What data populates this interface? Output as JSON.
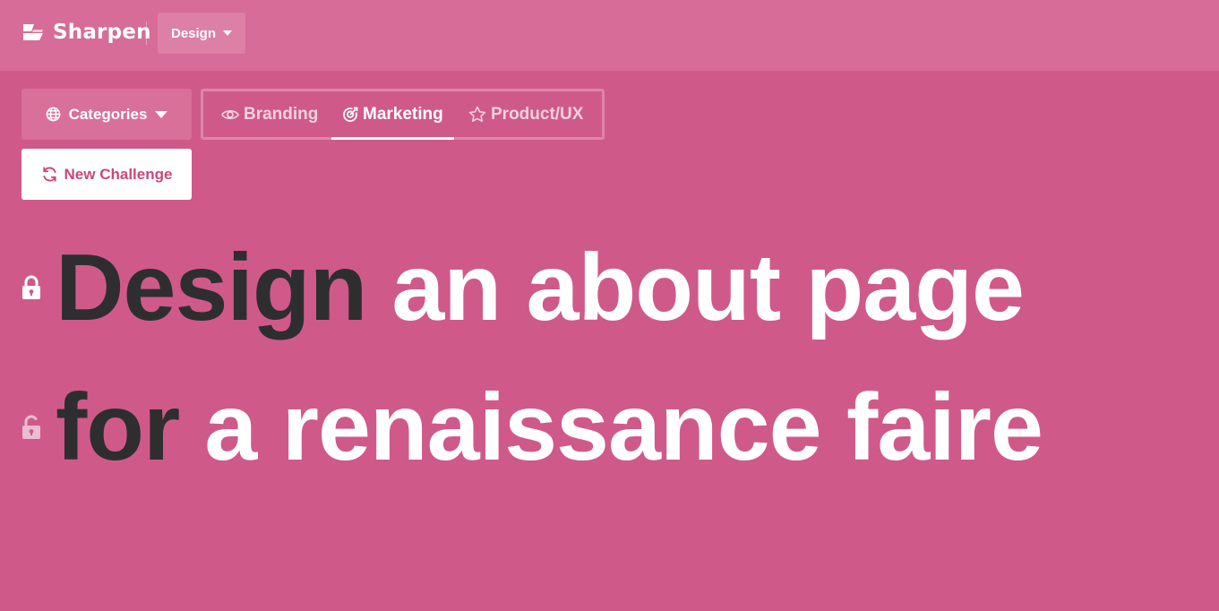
{
  "brand": {
    "name": "Sharpen",
    "logo_icon": "sharpen-logo-icon"
  },
  "nav": {
    "design_dropdown_label": "Design"
  },
  "categories_button": {
    "label": "Categories",
    "icon": "globe-icon"
  },
  "tabs": [
    {
      "label": "Branding",
      "icon": "eye-icon",
      "active": false
    },
    {
      "label": "Marketing",
      "icon": "target-icon",
      "active": true
    },
    {
      "label": "Product/UX",
      "icon": "star-icon",
      "active": false
    }
  ],
  "new_challenge_button": {
    "label": "New Challenge",
    "icon": "refresh-icon"
  },
  "challenge": {
    "line1": {
      "locked": true,
      "verb": "Design",
      "object": "an about page"
    },
    "line2": {
      "locked": false,
      "verb": "for",
      "object": "a renaissance faire"
    }
  },
  "colors": {
    "background": "#cf5a8a",
    "topbar": "#d66c97",
    "dark_text": "#2e2e30",
    "accent_text": "#c8487d"
  }
}
